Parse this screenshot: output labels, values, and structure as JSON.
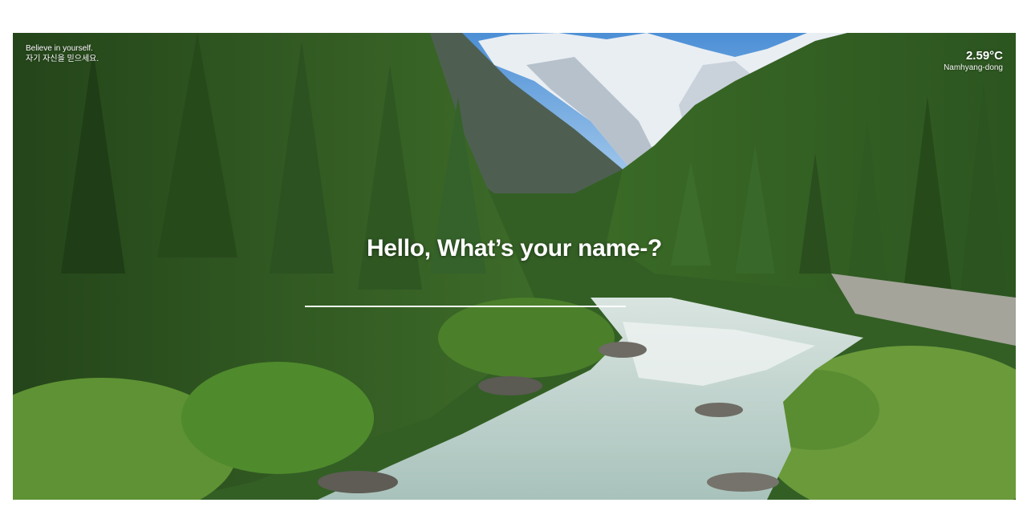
{
  "quote": {
    "line1": "Believe in yourself.",
    "line2": "자기 자신을 믿으세요."
  },
  "weather": {
    "temperature": "2.59°C",
    "location": "Namhyang-dong"
  },
  "greeting": {
    "text": "Hello, What’s your name-?"
  },
  "name_input": {
    "value": "",
    "placeholder": ""
  },
  "colors": {
    "text": "#ffffff",
    "page_background": "#ffffff"
  }
}
